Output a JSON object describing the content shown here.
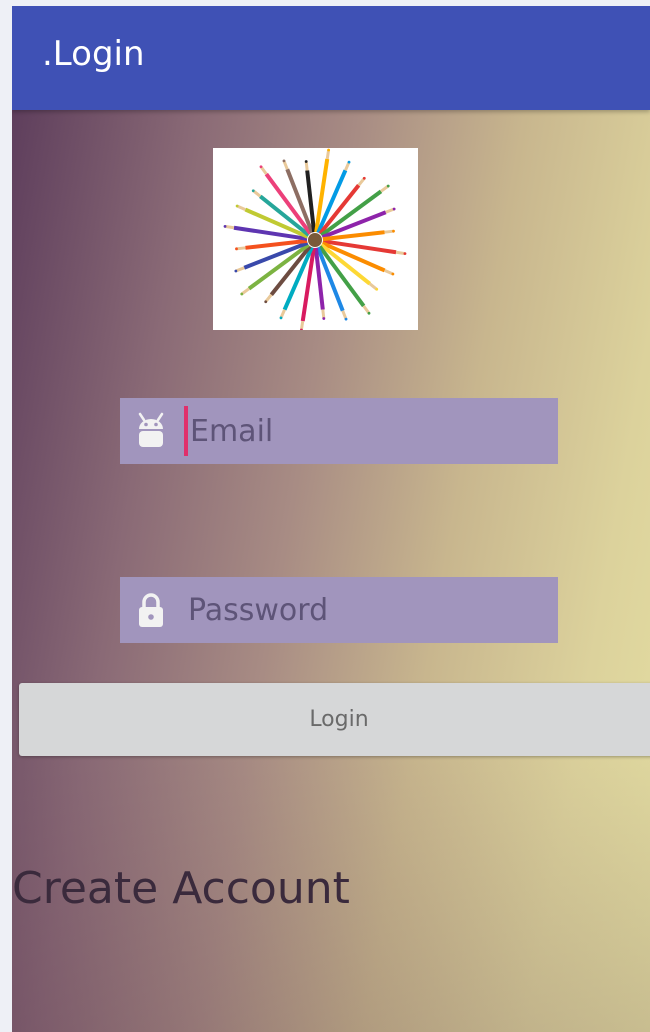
{
  "app_bar": {
    "title": ".Login",
    "color": "#3f51b5"
  },
  "logo": {
    "icon": "colored-pencils-image"
  },
  "email_field": {
    "icon": "android-icon",
    "placeholder": "Email",
    "value": ""
  },
  "password_field": {
    "icon": "lock-icon",
    "placeholder": "Password",
    "value": ""
  },
  "login_button": {
    "label": "Login"
  },
  "create_account": {
    "label": "Create Account"
  },
  "colors": {
    "field_background": "#a195bd",
    "cursor": "#e0306b",
    "button_background": "#d6d7d8"
  }
}
